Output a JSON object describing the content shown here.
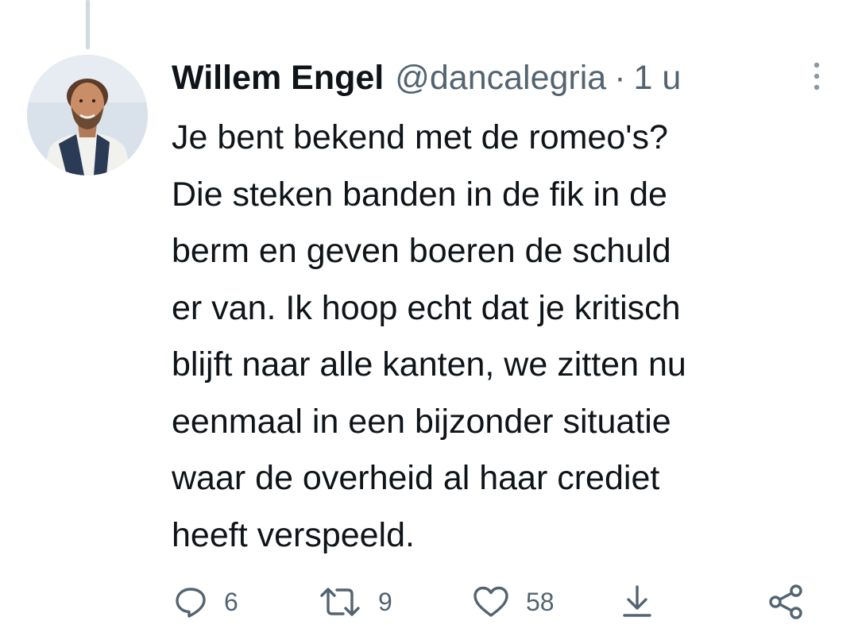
{
  "tweet": {
    "author_name": "Willem Engel",
    "handle": "@dancalegria",
    "separator": "·",
    "time": "1 u",
    "text_lines": [
      "Je bent bekend met de romeo's?",
      "Die steken banden in de fik in de",
      "berm en geven boeren de schuld",
      "er van. Ik hoop echt dat je kritisch",
      "blijft naar alle kanten, we zitten nu",
      "eenmaal in een bijzonder situatie",
      "waar de overheid al haar crediet",
      "heeft verspeeld."
    ],
    "stats": {
      "replies": "6",
      "retweets": "9",
      "likes": "58"
    }
  },
  "icons": {
    "more": "more-vertical-icon",
    "reply": "reply-icon",
    "retweet": "retweet-icon",
    "like": "heart-icon",
    "download": "download-icon",
    "share": "share-icon"
  },
  "colors": {
    "text": "#0f1419",
    "secondary": "#536471",
    "thread_line": "#cfd9de"
  }
}
